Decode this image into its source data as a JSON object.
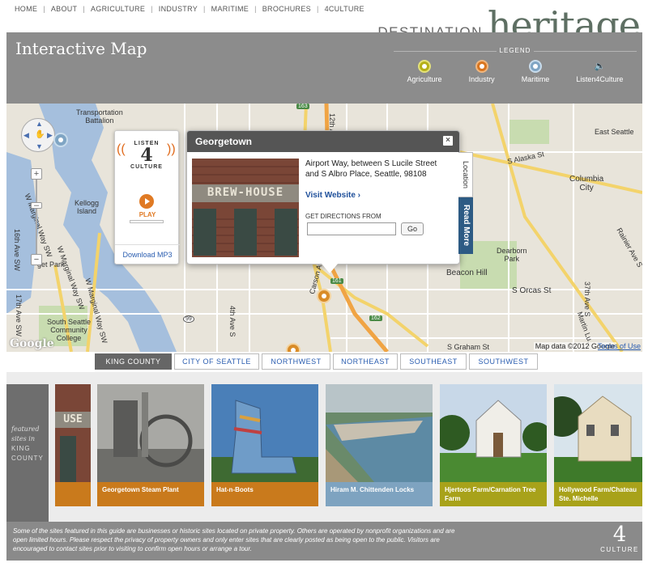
{
  "nav": {
    "items": [
      "HOME",
      "ABOUT",
      "AGRICULTURE",
      "INDUSTRY",
      "MARITIME",
      "BROCHURES",
      "4CULTURE"
    ]
  },
  "logo": {
    "destination": "DESTINATION",
    "heritage": "heritage"
  },
  "header": {
    "title": "Interactive Map"
  },
  "legend": {
    "title": "LEGEND",
    "items": [
      {
        "label": "Agriculture",
        "color": "#b5b017"
      },
      {
        "label": "Industry",
        "color": "#d9751f"
      },
      {
        "label": "Maritime",
        "color": "#7fa5c4"
      },
      {
        "label": "Listen4Culture",
        "color": "#8c8c8c"
      }
    ]
  },
  "map": {
    "labels": {
      "battalion": "Transportation\nBattalion",
      "kellogg": "Kellogg\nIsland",
      "marginal_sw": "W Marginal Way SW",
      "marginal_way": "W Marginal Way SW",
      "marginal_sw2": "W Marginal Way SW",
      "east_seattle": "East Seattle",
      "alaska": "S Alaska St",
      "columbia": "Columbia\nCity",
      "dearborn": "Dearborn\nPark",
      "beacon": "Beacon Hill",
      "orcas": "S Orcas St",
      "graham": "S Graham St",
      "south_seattle": "South Seattle\nCommunity\nCollege",
      "get_park": "get Park",
      "ave16": "16th Ave SW",
      "ave17": "17th Ave SW",
      "ave4": "4th Ave S",
      "carson": "Carson Ave S",
      "ave12": "12th Ave S",
      "rainier": "Rainier Ave S",
      "ave37": "37th Ave S",
      "martin": "Martin Lu...",
      "hw_163": "163",
      "hw_99": "99",
      "hw_161": "161",
      "hw_162": "162"
    },
    "mapdata": "Map data ©2012 Google",
    "terms": "Terms of Use",
    "google": "Google"
  },
  "audio": {
    "listen": "LISTEN",
    "four": "4",
    "culture": "CULTURE",
    "play": "PLAY",
    "download": "Download MP3"
  },
  "popup": {
    "title": "Georgetown",
    "close": "×",
    "address": "Airport Way, between S Lucile Street and S Albro Place, Seattle, 98108",
    "visit": "Visit Website ›",
    "directions_label": "GET DIRECTIONS FROM",
    "directions_value": "",
    "go": "Go",
    "photo_sign": "BREW-HOUSE",
    "tab_location": "Location",
    "tab_more": "Read More"
  },
  "regions": {
    "tabs": [
      "KING COUNTY",
      "CITY OF SEATTLE",
      "NORTHWEST",
      "NORTHEAST",
      "SOUTHEAST",
      "SOUTHWEST"
    ],
    "active": "KING COUNTY"
  },
  "featured": {
    "label_italic": "featured\nsites in",
    "label_caps": "KING\nCOUNTY",
    "first_sign": "USE",
    "cards": [
      {
        "title": "Georgetown Steam Plant",
        "color": "#c97a1c"
      },
      {
        "title": "Hat-n-Boots",
        "color": "#c97a1c"
      },
      {
        "title": "Hiram M. Chittenden Locks",
        "color": "#7ea3c0"
      },
      {
        "title": "Hjertoos Farm/Carnation Tree Farm",
        "color": "#a8a21a"
      },
      {
        "title": "Hollywood Farm/Chateau Ste. Michelle",
        "color": "#a8a21a"
      }
    ]
  },
  "footer": {
    "text": "Some of the sites featured in this guide are businesses or historic sites located on private property. Others are operated by nonprofit organizations and are open limited hours. Please respect the privacy of property owners and only enter sites that are clearly posted as being open to the public. Visitors are encouraged to contact sites prior to visiting to confirm open hours or arrange a tour.",
    "logo_num": "4",
    "logo_text": "CULTURE"
  }
}
